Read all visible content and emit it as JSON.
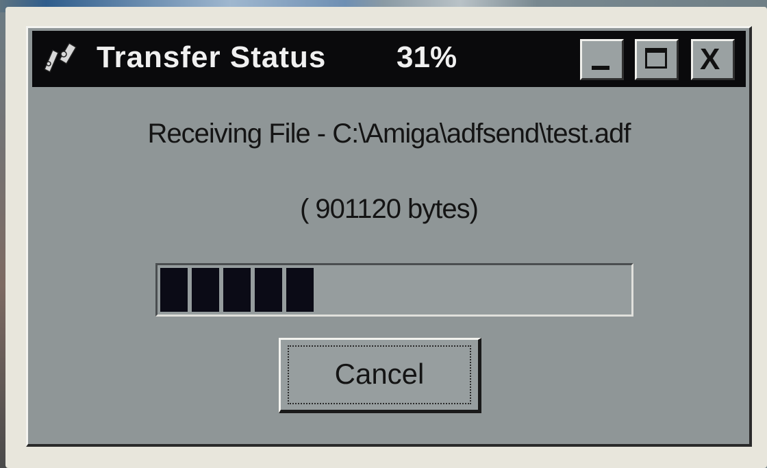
{
  "window": {
    "title": "Transfer Status",
    "percent_text": "31%",
    "icon": "transfer-icon"
  },
  "titlebar_buttons": {
    "minimize": "minimize-icon",
    "maximize": "maximize-icon",
    "close": "close-icon",
    "close_glyph": "X"
  },
  "body": {
    "file_text": "Receiving File - C:\\Amiga\\adfsend\\test.adf",
    "bytes_text": "( 901120 bytes)"
  },
  "progress": {
    "value_fraction": 0.31,
    "block_color": "#0b0b16"
  },
  "buttons": {
    "cancel_label": "Cancel"
  },
  "colors": {
    "dialog_face": "#8f9697",
    "titlebar": "#0a0a0c",
    "title_text": "#f0f0f0"
  }
}
